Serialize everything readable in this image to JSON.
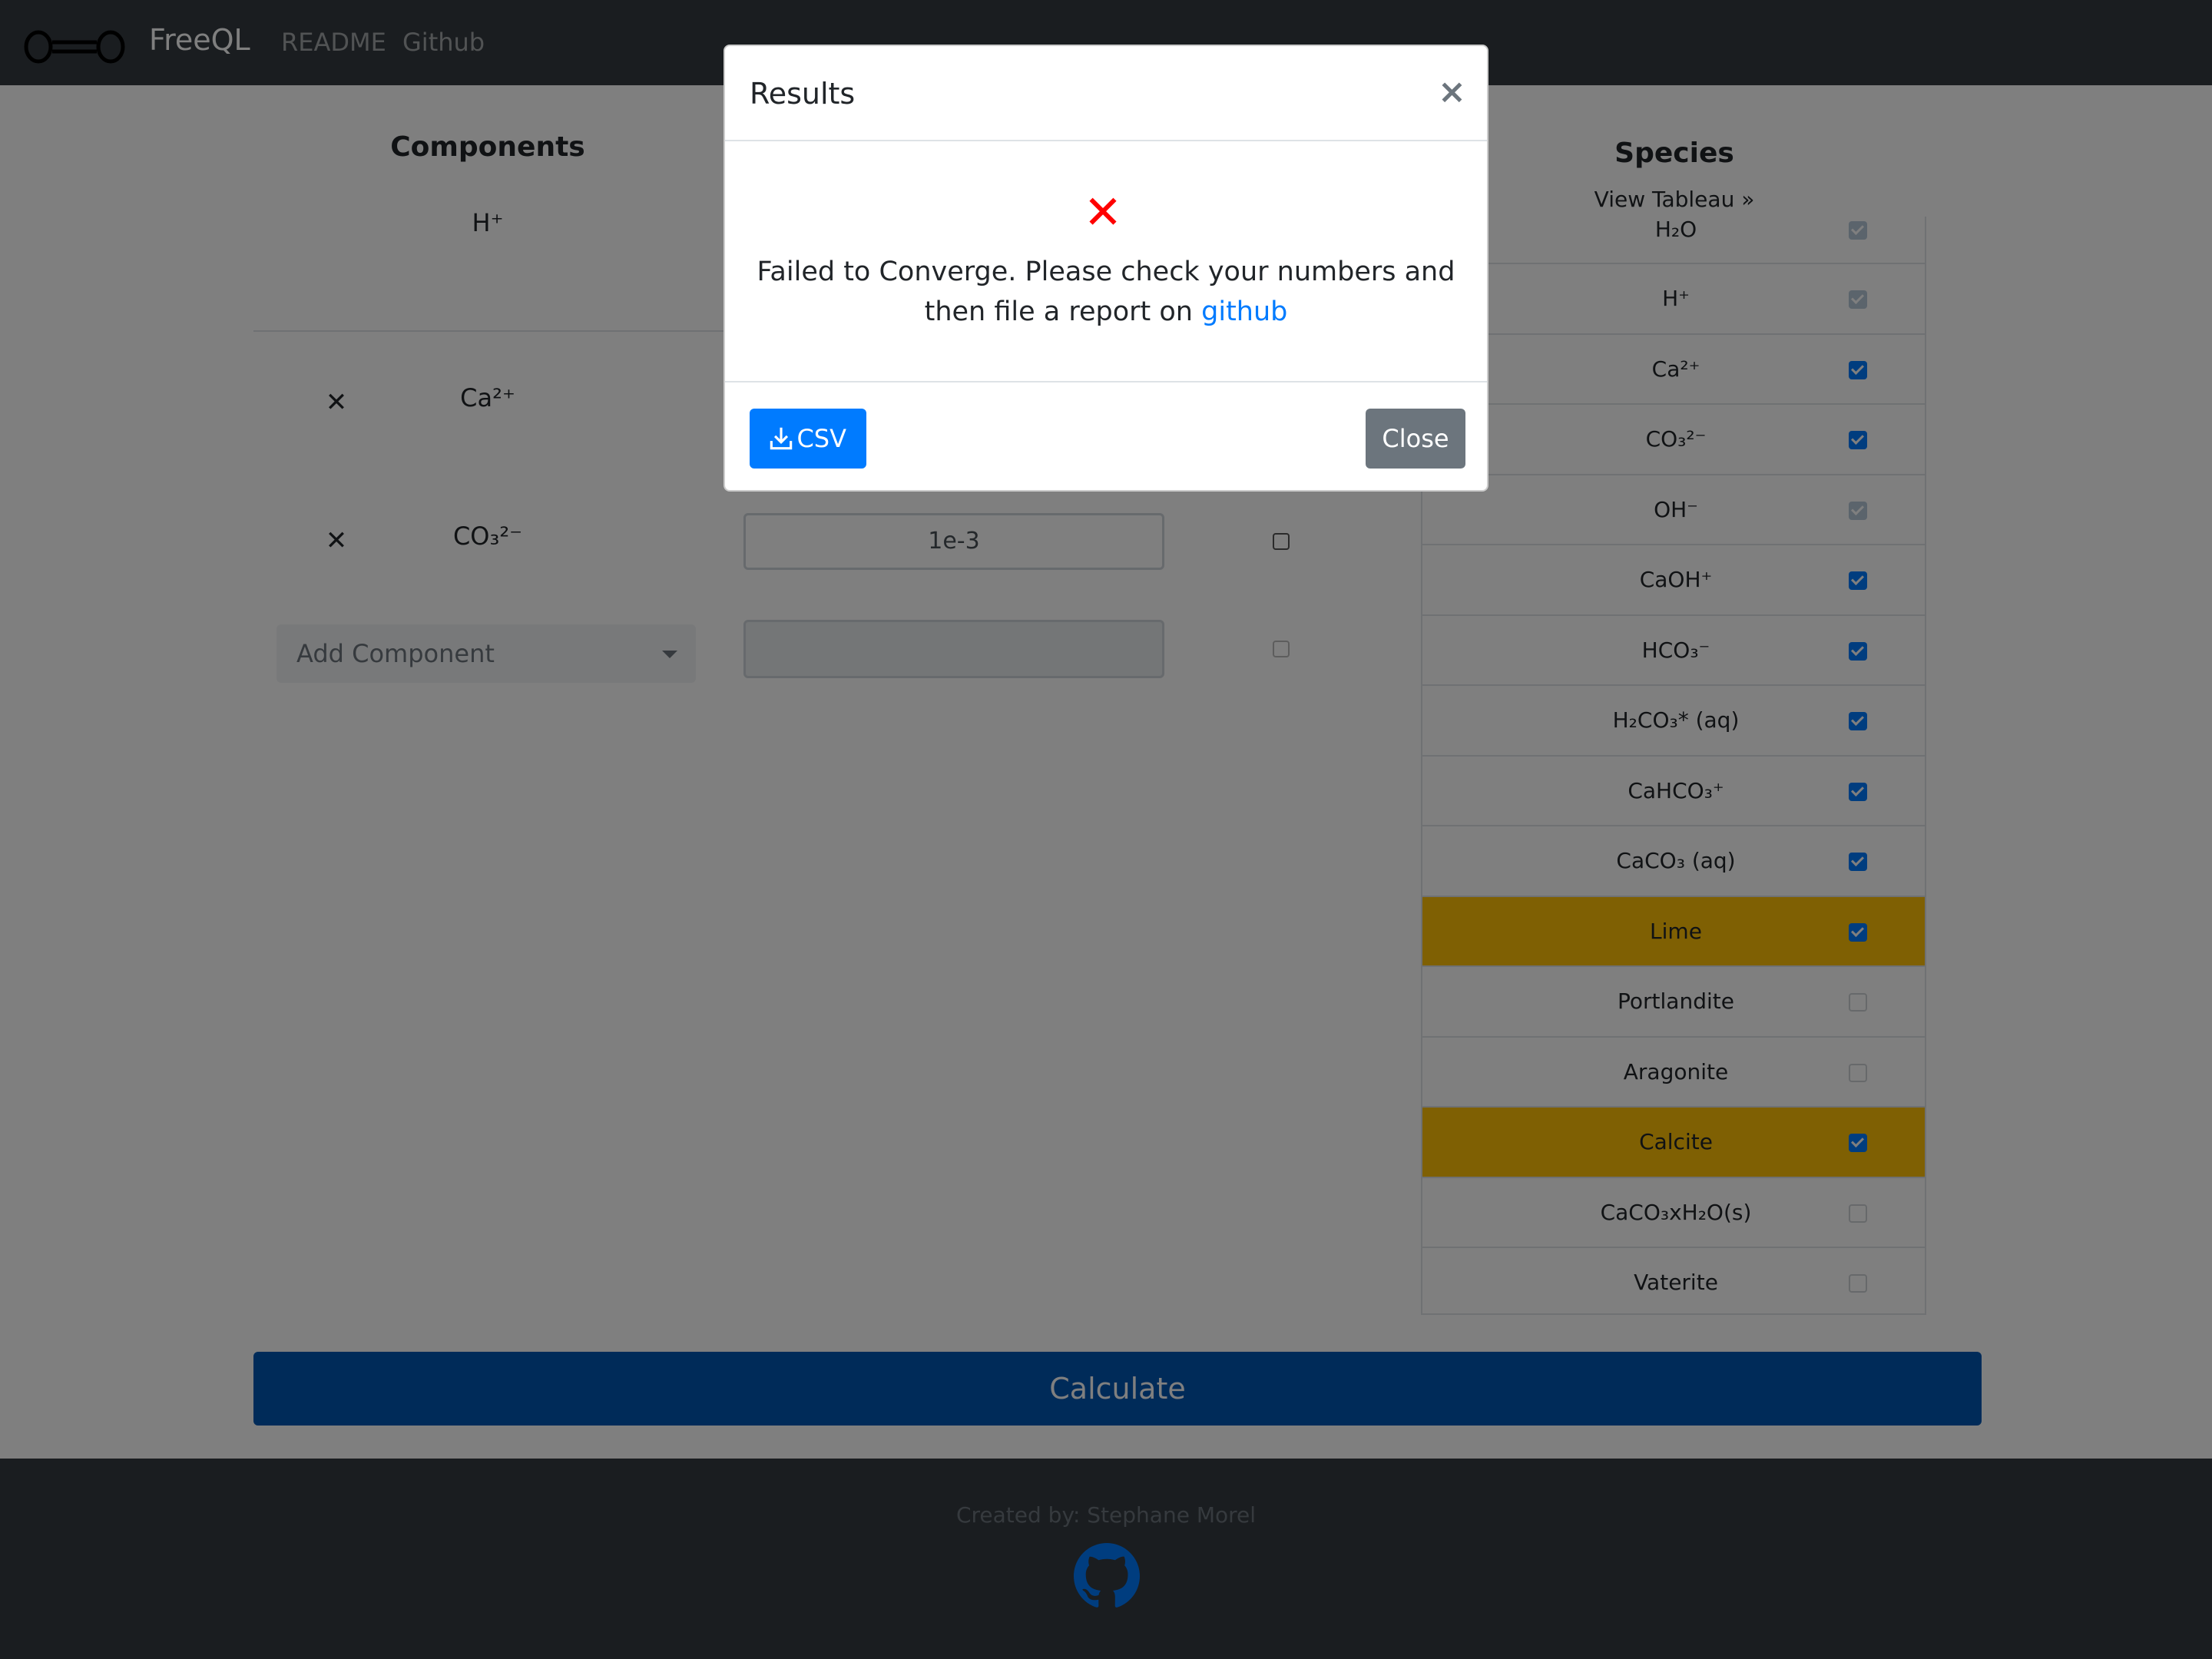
{
  "nav": {
    "brand": "FreeQL",
    "links": [
      "README",
      "Github"
    ]
  },
  "components": {
    "title": "Components",
    "fixed": "H⁺",
    "rows": [
      {
        "name": "Ca²⁺",
        "value": ""
      },
      {
        "name": "CO₃²⁻",
        "value": "1e-3"
      }
    ],
    "add_placeholder": "Add Component"
  },
  "species": {
    "title": "Species",
    "view_tableau": "View Tableau »",
    "items": [
      {
        "label": "H₂O",
        "state": "disabled-checked",
        "highlight": false
      },
      {
        "label": "H⁺",
        "state": "disabled-checked",
        "highlight": false
      },
      {
        "label": "Ca²⁺",
        "state": "checked",
        "highlight": false
      },
      {
        "label": "CO₃²⁻",
        "state": "checked",
        "highlight": false
      },
      {
        "label": "OH⁻",
        "state": "disabled-checked",
        "highlight": false
      },
      {
        "label": "CaOH⁺",
        "state": "checked",
        "highlight": false
      },
      {
        "label": "HCO₃⁻",
        "state": "checked",
        "highlight": false
      },
      {
        "label": "H₂CO₃* (aq)",
        "state": "checked",
        "highlight": false
      },
      {
        "label": "CaHCO₃⁺",
        "state": "checked",
        "highlight": false
      },
      {
        "label": "CaCO₃ (aq)",
        "state": "checked",
        "highlight": false
      },
      {
        "label": "Lime",
        "state": "checked",
        "highlight": true
      },
      {
        "label": "Portlandite",
        "state": "unchecked",
        "highlight": false
      },
      {
        "label": "Aragonite",
        "state": "unchecked",
        "highlight": false
      },
      {
        "label": "Calcite",
        "state": "checked",
        "highlight": true
      },
      {
        "label": "CaCO₃xH₂O(s)",
        "state": "unchecked",
        "highlight": false
      },
      {
        "label": "Vaterite",
        "state": "unchecked",
        "highlight": false
      }
    ]
  },
  "calculate_label": "Calculate",
  "footer": {
    "credit": "Created by: Stephane Morel"
  },
  "modal": {
    "title": "Results",
    "message": "Failed to Converge. Please check your numbers and then file a report on",
    "link_text": "github",
    "csv_label": "CSV",
    "close_label": "Close"
  },
  "colors": {
    "primary": "#007bff",
    "highlight": "#ffc107",
    "navbar": "#343a40",
    "error": "#ff0000"
  }
}
